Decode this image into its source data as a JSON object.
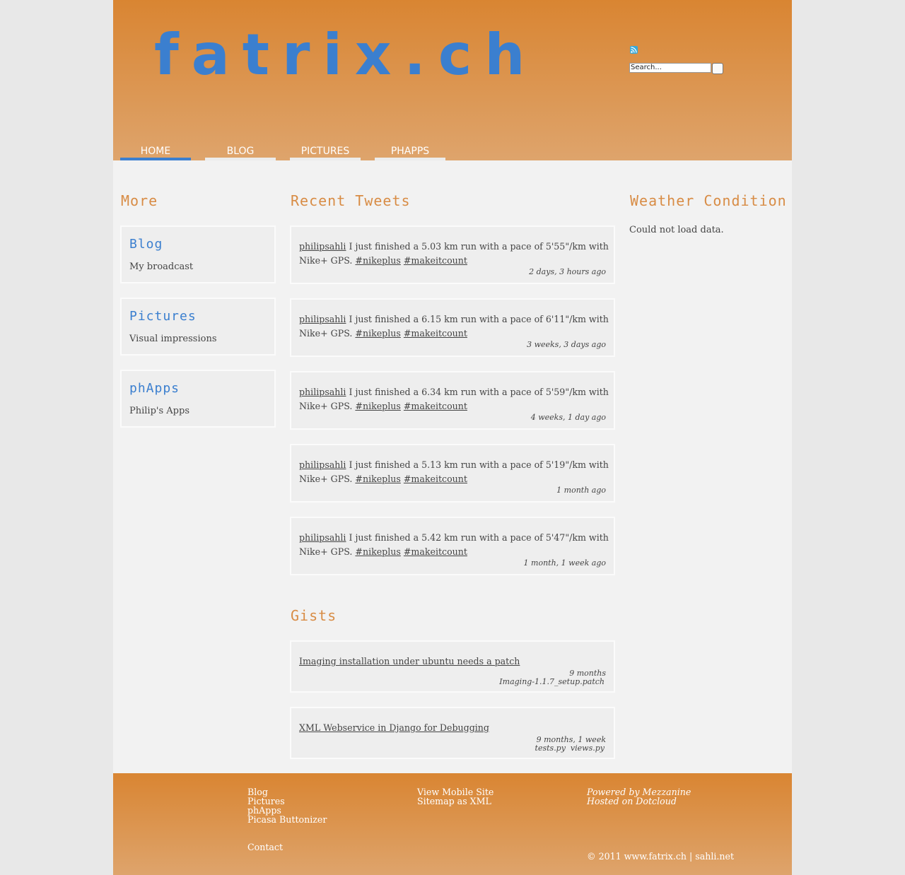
{
  "header": {
    "logo": "fatrix.ch",
    "search_placeholder": "Search...",
    "rss_icon": "rss-feed-icon"
  },
  "nav": [
    {
      "label": "Home",
      "active": true
    },
    {
      "label": "Blog",
      "active": false
    },
    {
      "label": "Pictures",
      "active": false
    },
    {
      "label": "phApps",
      "active": false
    }
  ],
  "more": {
    "title": "More",
    "items": [
      {
        "title": "Blog",
        "desc": "My broadcast"
      },
      {
        "title": "Pictures",
        "desc": "Visual impressions"
      },
      {
        "title": "phApps",
        "desc": "Philip's Apps"
      }
    ]
  },
  "tweets": {
    "title": "Recent Tweets",
    "items": [
      {
        "user": "philipsahli",
        "text": " I just finished a 5.03 km run with a pace of 5'55\"/km with Nike+ GPS. ",
        "tag1": "#nikeplus",
        "tag2": "#makeitcount",
        "time": "2 days, 3 hours ago"
      },
      {
        "user": "philipsahli",
        "text": " I just finished a 6.15 km run with a pace of 6'11\"/km with Nike+ GPS. ",
        "tag1": "#nikeplus",
        "tag2": "#makeitcount",
        "time": "3 weeks, 3 days ago"
      },
      {
        "user": "philipsahli",
        "text": " I just finished a 6.34 km run with a pace of 5'59\"/km with Nike+ GPS. ",
        "tag1": "#nikeplus",
        "tag2": "#makeitcount",
        "time": "4 weeks, 1 day ago"
      },
      {
        "user": "philipsahli",
        "text": " I just finished a 5.13 km run with a pace of 5'19\"/km with Nike+ GPS. ",
        "tag1": "#nikeplus",
        "tag2": "#makeitcount",
        "time": "1 month ago"
      },
      {
        "user": "philipsahli",
        "text": " I just finished a 5.42 km run with a pace of 5'47\"/km with Nike+ GPS. ",
        "tag1": "#nikeplus",
        "tag2": "#makeitcount",
        "time": "1 month, 1 week ago"
      }
    ]
  },
  "gists": {
    "title": "Gists",
    "items": [
      {
        "title": "Imaging installation under ubuntu needs a patch",
        "time": "9 months",
        "files": "Imaging-1.1.7_setup.patch"
      },
      {
        "title": "XML Webservice in Django for Debugging",
        "time": "9 months, 1 week",
        "files": "tests.py  views.py"
      }
    ]
  },
  "weather": {
    "title": "Weather Condition",
    "text": "Could not load data."
  },
  "footer": {
    "links": [
      "Blog",
      "Pictures",
      "phApps",
      "Picasa Buttonizer"
    ],
    "contact": "Contact",
    "mobile": "View Mobile Site",
    "sitemap": "Sitemap as XML",
    "powered": "Powered by Mezzanine",
    "hosted": "Hosted on Dotcloud",
    "copyright": "© 2011 www.fatrix.ch | sahli.net"
  },
  "colors": {
    "accent_orange": "#d98532",
    "accent_blue": "#3b7fcf"
  }
}
